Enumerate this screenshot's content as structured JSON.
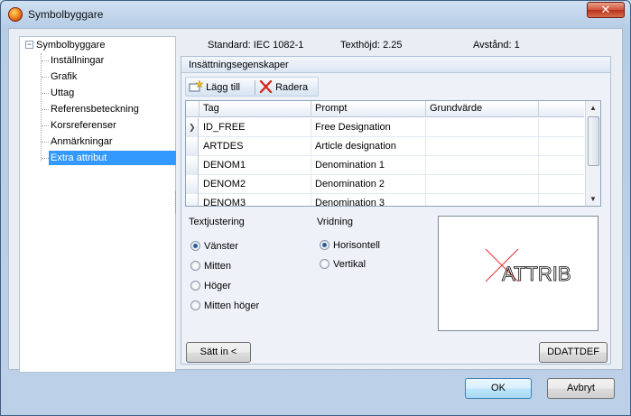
{
  "window": {
    "title": "Symbolbyggare",
    "close_glyph": "✕"
  },
  "tree": {
    "root_label": "Symbolbyggare",
    "expander": "−",
    "items": [
      {
        "label": "Inställningar"
      },
      {
        "label": "Grafik"
      },
      {
        "label": "Uttag"
      },
      {
        "label": "Referensbeteckning"
      },
      {
        "label": "Korsreferenser"
      },
      {
        "label": "Anmärkningar"
      },
      {
        "label": "Extra attribut",
        "selected": true
      }
    ]
  },
  "header": {
    "standard": "Standard: IEC 1082-1",
    "text_height": "Texthöjd: 2.25",
    "spacing": "Avstånd: 1"
  },
  "group": {
    "title": "Insättningsegenskaper"
  },
  "toolbar": {
    "add_label": "Lägg till",
    "delete_label": "Radera"
  },
  "grid": {
    "columns": [
      "Tag",
      "Prompt",
      "Grundvärde"
    ],
    "rows": [
      {
        "tag": "ID_FREE",
        "prompt": "Free Designation",
        "default": ""
      },
      {
        "tag": "ARTDES",
        "prompt": "Article designation",
        "default": ""
      },
      {
        "tag": "DENOM1",
        "prompt": "Denomination 1",
        "default": ""
      },
      {
        "tag": "DENOM2",
        "prompt": "Denomination 2",
        "default": ""
      },
      {
        "tag": "DENOM3",
        "prompt": "Denomination 3",
        "default": ""
      }
    ]
  },
  "text_justification": {
    "label": "Textjustering",
    "options": [
      {
        "label": "Vänster",
        "selected": true
      },
      {
        "label": "Mitten",
        "selected": false
      },
      {
        "label": "Höger",
        "selected": false
      },
      {
        "label": "Mitten höger",
        "selected": false
      }
    ]
  },
  "rotation": {
    "label": "Vridning",
    "options": [
      {
        "label": "Horisontell",
        "selected": true
      },
      {
        "label": "Vertikal",
        "selected": false
      }
    ]
  },
  "preview": {
    "text": "ATTRIB",
    "marker_color": "#e03030"
  },
  "buttons": {
    "insert": "Sätt in <",
    "ddattdef": "DDATTDEF",
    "ok": "OK",
    "cancel": "Avbryt"
  }
}
